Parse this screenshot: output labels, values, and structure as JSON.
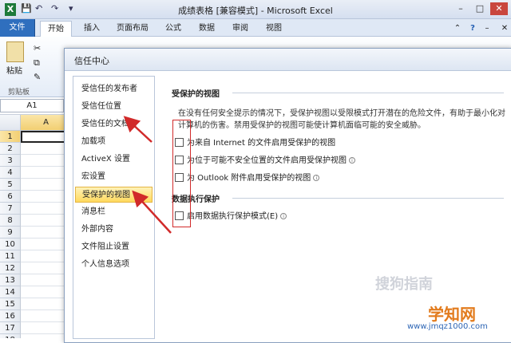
{
  "window": {
    "title": "成绩表格 [兼容模式] - Microsoft Excel",
    "qat_icons": [
      "excel-logo-icon",
      "save-icon",
      "undo-icon",
      "redo-icon",
      "customize-qat-icon"
    ],
    "controls": [
      "minimize-icon",
      "maximize-icon",
      "close-icon"
    ]
  },
  "ribbon": {
    "tabs": [
      "文件",
      "开始",
      "插入",
      "页面布局",
      "公式",
      "数据",
      "审阅",
      "视图"
    ],
    "paste_label": "粘贴",
    "clipboard_label": "剪贴板"
  },
  "sheet": {
    "name_box": "A1",
    "column": "A",
    "rows": [
      "1",
      "2",
      "3",
      "4",
      "5",
      "6",
      "7",
      "8",
      "9",
      "10",
      "11",
      "12",
      "13",
      "14",
      "15",
      "16",
      "17",
      "18"
    ]
  },
  "dialog": {
    "title": "信任中心",
    "nav": [
      "受信任的发布者",
      "受信任位置",
      "受信任的文档",
      "加载项",
      "ActiveX 设置",
      "宏设置",
      "受保护的视图",
      "消息栏",
      "外部内容",
      "文件阻止设置",
      "个人信息选项"
    ],
    "selected_index": 6,
    "protected_view": {
      "heading": "受保护的视图",
      "description": "在没有任何安全提示的情况下，受保护视图以受限模式打开潜在的危险文件，有助于最小化对计算机的伤害。禁用受保护的视图可能使计算机面临可能的安全威胁。",
      "options": [
        {
          "label": "为来自 Internet 的文件启用受保护的视图",
          "checked": false
        },
        {
          "label": "为位于可能不安全位置的文件启用受保护视图",
          "checked": false
        },
        {
          "label": "为 Outlook 附件启用受保护的视图",
          "checked": false
        }
      ]
    },
    "dep": {
      "heading": "数据执行保护",
      "option": {
        "label": "启用数据执行保护模式(E)",
        "checked": false
      }
    }
  },
  "watermarks": {
    "sogou": "搜狗指南",
    "site_logo": "学知网",
    "site_url": "www.jmqz1000.com"
  },
  "colors": {
    "annotation_red": "#d12a2a",
    "selected_item": "#ffd95e",
    "file_tab": "#2f6fbe"
  }
}
